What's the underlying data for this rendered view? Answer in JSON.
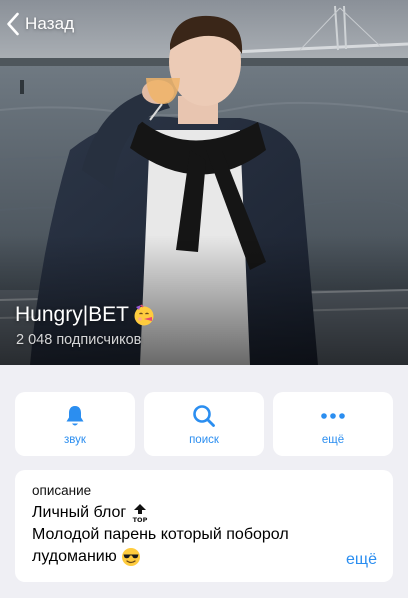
{
  "header": {
    "back_label": "Назад",
    "back_icon": "chevron-left-icon"
  },
  "channel": {
    "title": "Hungry|BET",
    "title_emoji": "face-with-party-horn-emoji",
    "subscribers": "2 048 подписчиков"
  },
  "actions": [
    {
      "label": "звук",
      "icon": "bell-icon"
    },
    {
      "label": "поиск",
      "icon": "search-icon"
    },
    {
      "label": "ещё",
      "icon": "more-dots-icon"
    }
  ],
  "about": {
    "label": "описание",
    "line1": "Личный блог",
    "line1_emoji": "top-arrow-emoji",
    "line2": "Молодой парень который поборол",
    "line3": "лудоманию",
    "line3_emoji": "smiling-face-with-sunglasses-emoji",
    "more_label": "ещё"
  },
  "colors": {
    "accent": "#2b8ef0",
    "background": "#efeff4",
    "card": "#ffffff"
  }
}
